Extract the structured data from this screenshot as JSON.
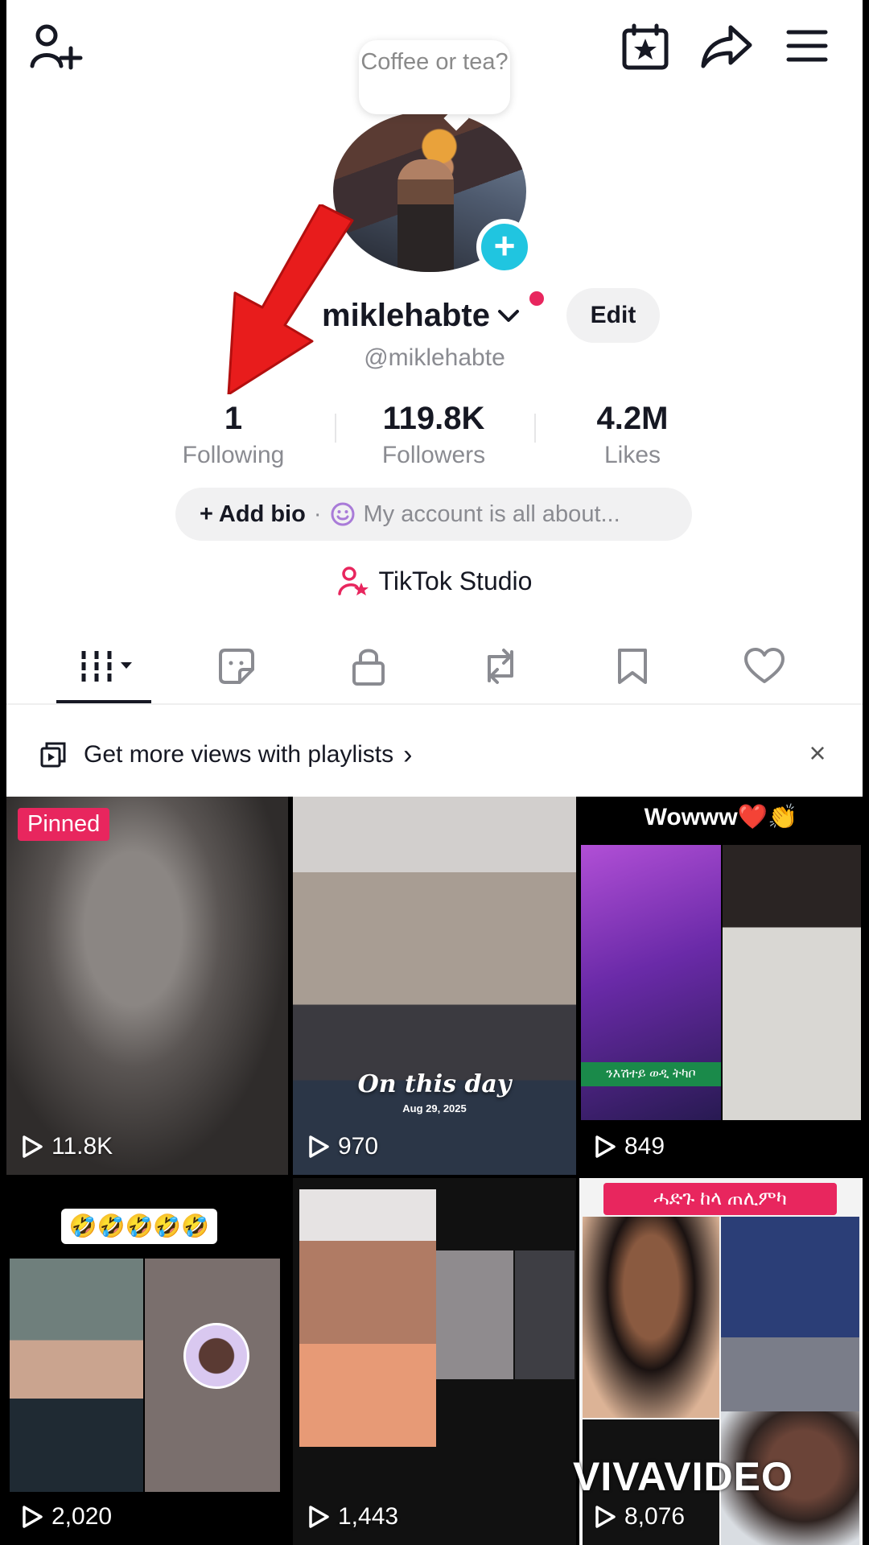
{
  "profile": {
    "speech_bubble": "Coffee or tea?",
    "username": "miklehabte",
    "handle": "@miklehabte",
    "edit_label": "Edit",
    "stats": {
      "following": {
        "value": "1",
        "label": "Following"
      },
      "followers": {
        "value": "119.8K",
        "label": "Followers"
      },
      "likes": {
        "value": "4.2M",
        "label": "Likes"
      }
    },
    "bio": {
      "add_label": "+ Add bio",
      "separator": "·",
      "placeholder": "My account is all about..."
    },
    "studio_label": "TikTok Studio"
  },
  "tabs": [
    {
      "name": "videos",
      "icon": "grid-icon"
    },
    {
      "name": "favorites",
      "icon": "sticker-icon"
    },
    {
      "name": "private",
      "icon": "lock-icon"
    },
    {
      "name": "reposts",
      "icon": "repost-icon"
    },
    {
      "name": "saved",
      "icon": "bookmark-icon"
    },
    {
      "name": "liked",
      "icon": "heart-icon"
    }
  ],
  "playlist_banner": {
    "text": "Get more views with playlists",
    "chevron": "›",
    "close": "×"
  },
  "videos": [
    {
      "views": "11.8K",
      "badge": "Pinned"
    },
    {
      "views": "970",
      "overlay_title": "On this day",
      "overlay_date": "Aug 29, 2025"
    },
    {
      "views": "849",
      "caption": "Wowww❤️👏",
      "band": "ንእሽተይ ወዲ ትካቦ"
    },
    {
      "views": "2,020",
      "emoji": "🤣🤣🤣🤣🤣"
    },
    {
      "views": "1,443"
    },
    {
      "views": "8,076",
      "caption": "ሓድጉ ከላ ጠሊምካ"
    }
  ],
  "watermark": "VIVAVIDEO",
  "colors": {
    "accent_pink": "#e8265e",
    "avatar_plus": "#20c5e0",
    "annotation_arrow": "#e81c1c"
  }
}
